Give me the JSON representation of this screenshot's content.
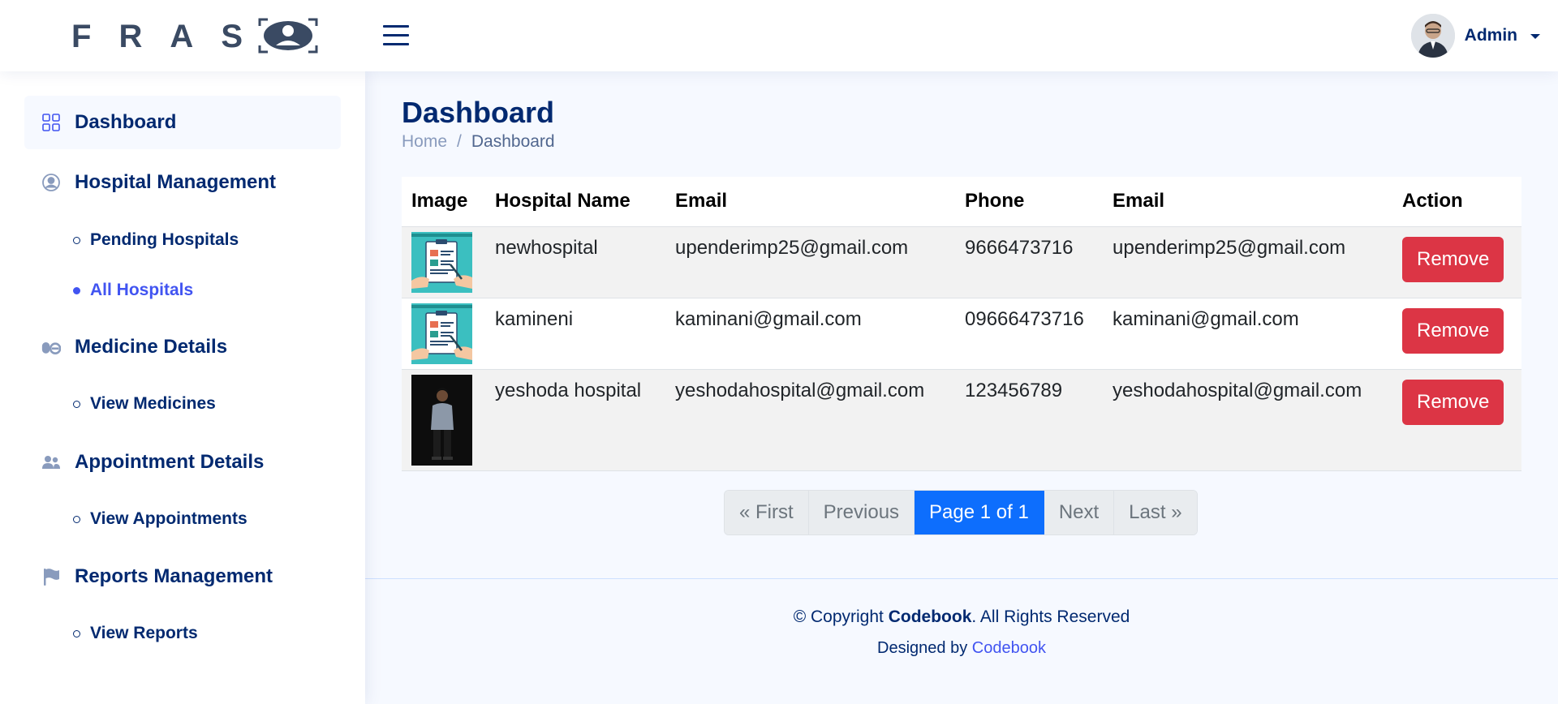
{
  "header": {
    "logo_text": "FRAS",
    "user_name": "Admin"
  },
  "sidebar": {
    "items": [
      {
        "label": "Dashboard",
        "icon": "grid-icon"
      },
      {
        "label": "Hospital Management",
        "icon": "person-circle-icon"
      },
      {
        "label": "Medicine Details",
        "icon": "capsule-icon"
      },
      {
        "label": "Appointment Details",
        "icon": "people-icon"
      },
      {
        "label": "Reports Management",
        "icon": "flag-icon"
      }
    ],
    "sub_items": {
      "pending_hospitals": "Pending Hospitals",
      "all_hospitals": "All Hospitals",
      "view_medicines": "View Medicines",
      "view_appointments": "View Appointments",
      "view_reports": "View Reports"
    }
  },
  "main": {
    "page_title": "Dashboard",
    "breadcrumb": {
      "home": "Home",
      "separator": "/",
      "current": "Dashboard"
    },
    "table": {
      "headers": [
        "Image",
        "Hospital Name",
        "Email",
        "Phone",
        "Email",
        "Action"
      ],
      "rows": [
        {
          "name": "newhospital",
          "email": "upenderimp25@gmail.com",
          "phone": "9666473716",
          "email2": "upenderimp25@gmail.com",
          "action": "Remove",
          "image": "medical-record-image"
        },
        {
          "name": "kamineni",
          "email": "kaminani@gmail.com",
          "phone": "09666473716",
          "email2": "kaminani@gmail.com",
          "action": "Remove",
          "image": "medical-record-image"
        },
        {
          "name": "yeshoda hospital",
          "email": "yeshodahospital@gmail.com",
          "phone": "123456789",
          "email2": "yeshodahospital@gmail.com",
          "action": "Remove",
          "image": "person-photo"
        }
      ]
    },
    "pagination": {
      "first": "« First",
      "previous": "Previous",
      "current": "Page 1 of 1",
      "next": "Next",
      "last": "Last »"
    }
  },
  "footer": {
    "copyright_prefix": "© Copyright ",
    "copyright_brand": "Codebook",
    "copyright_suffix": ". All Rights Reserved",
    "designed_by": "Designed by ",
    "designer": "Codebook"
  },
  "colors": {
    "brand": "#012970",
    "accent": "#4154f1",
    "danger": "#dc3545",
    "primary": "#0d6efd"
  }
}
